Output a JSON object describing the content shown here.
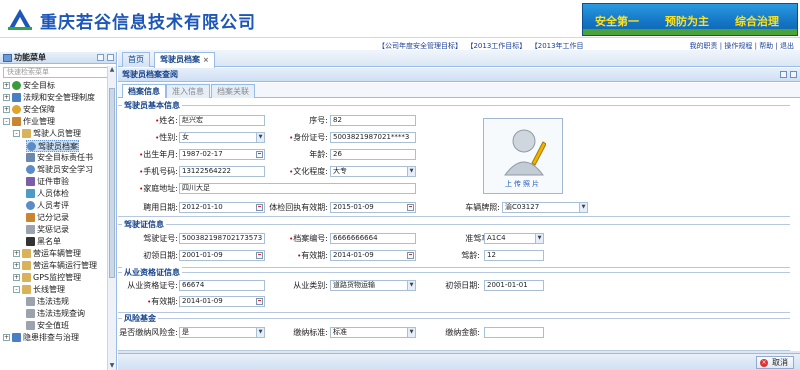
{
  "header": {
    "company": "重庆若谷信息技术有限公司",
    "banner": [
      "安全第一",
      "预防为主",
      "综合治理"
    ]
  },
  "topbar": {
    "news": [
      "【公司年度安全管理目标】",
      "【2013工作目标】",
      "【2013年工作目"
    ],
    "links": [
      "我的职责",
      "操作规程",
      "帮助",
      "退出"
    ]
  },
  "menu": {
    "title": "功能菜单",
    "search_placeholder": "快速检索菜单",
    "items": [
      "安全目标",
      "法规和安全管理制度",
      "安全保障",
      "作业管理",
      "驾驶人员管理",
      "驾驶员档案",
      "安全目标责任书",
      "驾驶员安全学习",
      "证件审验",
      "人员体检",
      "人员考评",
      "记分记录",
      "奖惩记录",
      "黑名单",
      "营运车辆管理",
      "营运车辆运行管理",
      "GPS监控管理",
      "长线管理",
      "违法违规",
      "违法违规查询",
      "安全值班",
      "隐患排查与治理"
    ]
  },
  "tabs": {
    "home": "首页",
    "archive": "驾驶员档案"
  },
  "panel": {
    "title": "驾驶员档案查阅"
  },
  "subtabs": [
    "档案信息",
    "准入信息",
    "档案关联"
  ],
  "sections": {
    "basic": "驾驶员基本信息",
    "license": "驾驶证信息",
    "qual": "从业资格证信息",
    "fund": "风险基金"
  },
  "photo": {
    "caption": "上传照片"
  },
  "basic": {
    "name_l": "姓名:",
    "name": "赵兴宏",
    "seq_l": "序号:",
    "seq": "82",
    "gender_l": "性别:",
    "gender": "女",
    "id_l": "身份证号:",
    "id": "5003821987021****3",
    "birth_l": "出生年月:",
    "birth": "1987-02-17",
    "age_l": "年龄:",
    "age": "26",
    "phone_l": "手机号码:",
    "phone": "13122564222",
    "edu_l": "文化程度:",
    "edu": "大专",
    "addr_l": "家庭地址:",
    "addr": "四川大足",
    "hire_l": "聘用日期:",
    "hire": "2012-01-10",
    "exam_l": "体检回执有效期:",
    "exam": "2015-01-09",
    "plate_l": "车辆牌照:",
    "plate": "渝C03127"
  },
  "license": {
    "no_l": "驾驶证号:",
    "no": "500382198702173573",
    "file_l": "档案编号:",
    "file": "6666666664",
    "type_l": "准驾车型:",
    "type": "A1C4",
    "first_l": "初领日期:",
    "first": "2001-01-09",
    "valid_l": "有效期:",
    "valid": "2014-01-09",
    "age_l": "驾龄:",
    "age": "12"
  },
  "qual": {
    "no_l": "从业资格证号:",
    "no": "66674",
    "cat_l": "从业类别:",
    "cat": "道路货物运输",
    "first_l": "初领日期:",
    "first": "2001-01-01",
    "valid_l": "有效期:",
    "valid": "2014-01-09"
  },
  "fund": {
    "paid_l": "是否缴纳风险金:",
    "paid": "是",
    "std_l": "缴纳标准:",
    "std": "标准",
    "amt_l": "缴纳金额:",
    "amt": ""
  },
  "footer": {
    "cancel": "取消"
  }
}
